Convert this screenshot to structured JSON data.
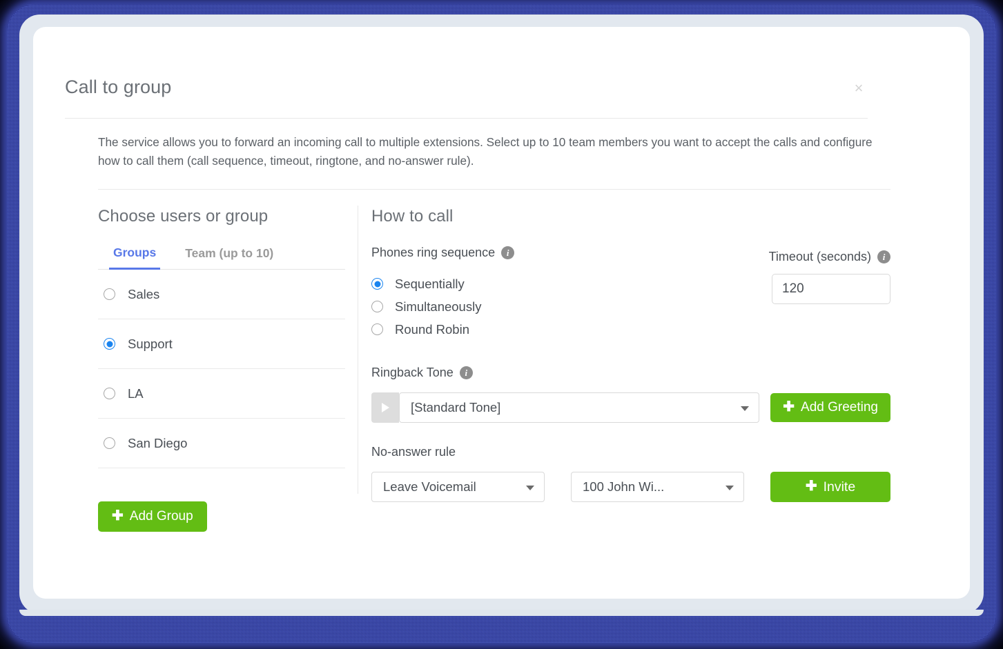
{
  "modal": {
    "title": "Call to group",
    "close_label": "×",
    "description": "The service allows you to forward an incoming call to multiple extensions. Select up to 10 team members you want to accept the calls and configure how to call them (call sequence, timeout, ringtone, and no-answer rule)."
  },
  "left_panel": {
    "heading": "Choose users or group",
    "tabs": [
      {
        "label": "Groups",
        "active": true
      },
      {
        "label": "Team (up to 10)",
        "active": false
      }
    ],
    "groups": [
      {
        "label": "Sales",
        "selected": false
      },
      {
        "label": "Support",
        "selected": true
      },
      {
        "label": "LA",
        "selected": false
      },
      {
        "label": "San Diego",
        "selected": false
      }
    ],
    "add_group_button": "Add Group",
    "add_group_icon": "plus-icon"
  },
  "right_panel": {
    "heading": "How to call",
    "ring_sequence": {
      "label": "Phones ring sequence",
      "info_icon": "info-icon",
      "options": [
        {
          "label": "Sequentially",
          "selected": true
        },
        {
          "label": "Simultaneously",
          "selected": false
        },
        {
          "label": "Round Robin",
          "selected": false
        }
      ]
    },
    "timeout": {
      "label": "Timeout (seconds)",
      "info_icon": "info-icon",
      "value": "120",
      "placeholder": "120"
    },
    "ringback": {
      "label": "Ringback Tone",
      "info_icon": "info-icon",
      "play_icon": "play-icon",
      "selected": "[Standard Tone]",
      "caret_icon": "chevron-down-icon",
      "add_greeting_button": "Add Greeting",
      "add_greeting_icon": "plus-icon"
    },
    "no_answer": {
      "label": "No-answer rule",
      "rule_selected": "Leave Voicemail",
      "target_selected": "100 John Wi...",
      "caret_icon": "chevron-down-icon",
      "invite_button": "Invite",
      "invite_icon": "plus-icon"
    }
  },
  "colors": {
    "accent_blue": "#5878e8",
    "radio_blue": "#1a84ef",
    "green": "#63bd14",
    "text_gray": "#4a4f55",
    "heading_gray": "#6b7076",
    "glow_blue": "#3a47a8"
  }
}
